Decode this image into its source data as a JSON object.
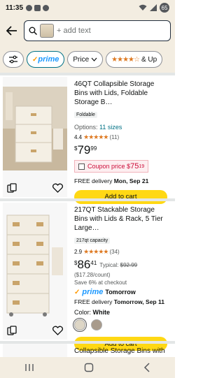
{
  "status": {
    "time": "11:35",
    "battery": "65"
  },
  "search": {
    "placeholder": "+ add text"
  },
  "filters": {
    "prime_label": "prime",
    "price_label": "Price",
    "rating_label": "& Up"
  },
  "products": [
    {
      "title": "46QT Collapsible Storage Bins with Lids, Foldable Storage B…",
      "tag": "Foldable",
      "options_prefix": "Options:",
      "options_link": "11 sizes",
      "rating": "4.4",
      "stars": "★★★★★",
      "review_count": "(11)",
      "price_symbol": "$",
      "price_whole": "79",
      "price_fraction": "99",
      "coupon_label": "Coupon price",
      "coupon_symbol": "$",
      "coupon_whole": "75",
      "coupon_fraction": "19",
      "delivery_prefix": "FREE delivery",
      "delivery_date": "Mon, Sep 21",
      "cart_label": "Add to cart"
    },
    {
      "title": "217QT Stackable Storage Bins with Lids & Rack, 5 Tier Large…",
      "tag": "217qt capacity",
      "rating": "2.9",
      "stars": "★★★★★",
      "review_count": "(34)",
      "price_symbol": "$",
      "price_whole": "86",
      "price_fraction": "41",
      "typical_label": "Typical:",
      "typical_price": "$92.99",
      "unit_price": "($17.28/count)",
      "save_text": "Save 6% at checkout",
      "prime_label": "prime",
      "prime_delivery": "Tomorrow",
      "delivery_prefix": "FREE delivery",
      "delivery_date": "Tomorrow, Sep 11",
      "color_label": "Color:",
      "color_value": "White",
      "swatch_colors": [
        "#ddd6c6",
        "#a89b8c"
      ],
      "cart_label": "Add to cart"
    },
    {
      "title": "Collapsible Storage Bins with"
    }
  ],
  "colors": {
    "header_bg": "#f3ede1",
    "cart_button": "#ffd814",
    "link": "#007185",
    "star": "#de7921",
    "coupon_red": "#cc0c39"
  }
}
